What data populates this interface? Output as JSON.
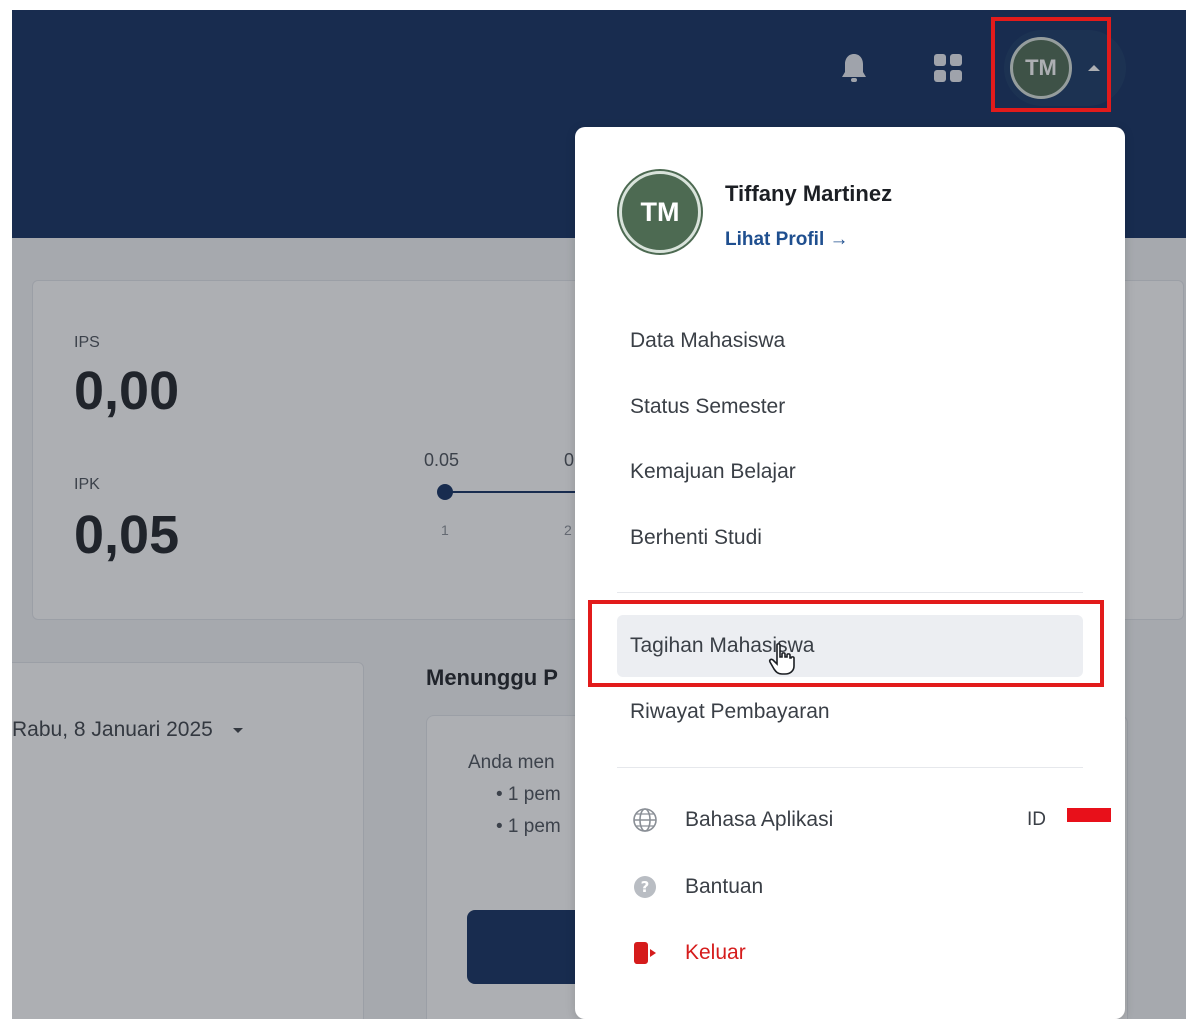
{
  "header": {
    "avatar_initials": "TM"
  },
  "stats": {
    "ips_label": "IPS",
    "ips_value": "0,00",
    "ipk_label": "IPK",
    "ipk_value": "0,05",
    "chart_value_1": "0.05",
    "chart_value_2": "0",
    "chart_tick_1": "1",
    "chart_tick_2": "2"
  },
  "schedule": {
    "date": "Rabu, 8 Januari 2025"
  },
  "waiting": {
    "title": "Menunggu P",
    "text": "Anda men",
    "bullets": [
      "• 1 pem",
      "• 1 pem"
    ]
  },
  "menu": {
    "avatar_initials": "TM",
    "name": "Tiffany Martinez",
    "profile_link": "Lihat Profil →",
    "items": [
      {
        "label": "Data Mahasiswa"
      },
      {
        "label": "Status Semester"
      },
      {
        "label": "Kemajuan Belajar"
      },
      {
        "label": "Berhenti Studi"
      },
      {
        "label": "Tagihan Mahasiswa"
      },
      {
        "label": "Riwayat Pembayaran"
      }
    ],
    "language_label": "Bahasa Aplikasi",
    "language_code": "ID",
    "help_label": "Bantuan",
    "logout_label": "Keluar"
  },
  "colors": {
    "header_bg": "#0f2d5e",
    "avatar_bg": "#4d6a52",
    "highlight": "#e21b1b",
    "logout": "#d51c1c",
    "link": "#1f4f8f"
  },
  "icons": [
    "bell-icon",
    "apps-grid-icon",
    "caret-up-icon",
    "caret-down-icon",
    "globe-icon",
    "help-icon",
    "logout-icon",
    "hand-cursor-icon",
    "arrow-right-icon"
  ]
}
